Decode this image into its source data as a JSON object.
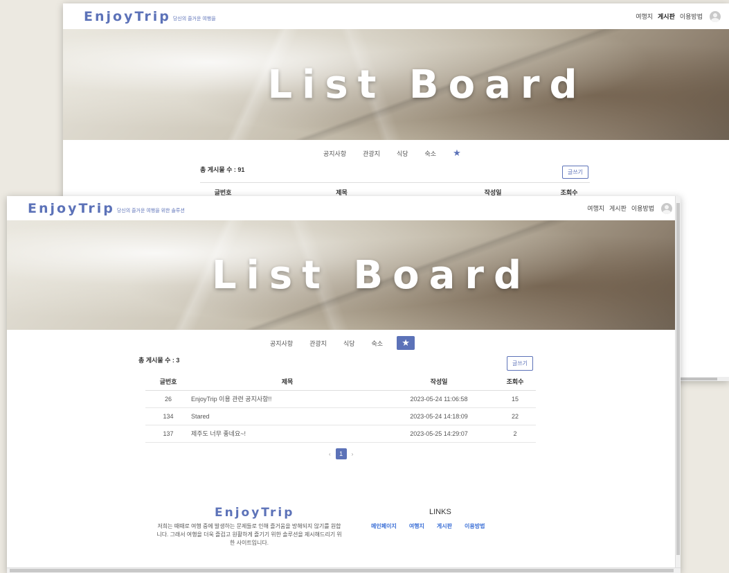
{
  "back_window": {
    "logo": "EnjoyTrip",
    "tagline": "당신의 즐거운 여행을",
    "nav": [
      "여행지",
      "게시판",
      "이용방법"
    ],
    "hero_title": "List Board",
    "tabs": [
      "공지사항",
      "관광지",
      "식당",
      "숙소"
    ],
    "total_label": "총 게시물 수 : 91",
    "write_button": "글쓰기",
    "columns": [
      "글번호",
      "제목",
      "작성일",
      "조회수"
    ]
  },
  "front_window": {
    "logo": "EnjoyTrip",
    "tagline": "당신의 즐거운 여행을 위한 솔루션",
    "nav": [
      "여행지",
      "게시판",
      "이용방법"
    ],
    "hero_title": "List Board",
    "tabs": [
      "공지사항",
      "관광지",
      "식당",
      "숙소"
    ],
    "total_label": "총 게시물 수 : 3",
    "write_button": "글쓰기",
    "columns": [
      "글번호",
      "제목",
      "작성일",
      "조회수"
    ],
    "rows": [
      {
        "no": "26",
        "title": "EnjoyTrip 이용 관련 공지사항!!",
        "date": "2023-05-24 11:06:58",
        "views": "15"
      },
      {
        "no": "134",
        "title": "Stared",
        "date": "2023-05-24 14:18:09",
        "views": "22"
      },
      {
        "no": "137",
        "title": "제주도 너무 좋네요~!",
        "date": "2023-05-25 14:29:07",
        "views": "2"
      }
    ],
    "pagination": {
      "prev": "‹",
      "current": "1",
      "next": "›"
    },
    "footer": {
      "logo": "EnjoyTrip",
      "description": "저희는 때때로 여행 중에 발생하는 문제들로 인해 즐거움을 방해되지 않기를 원합니다. 그래서 여행을 더욱 즐겁고 원활하게 즐기기 위한 솔루션을 제시해드리기 위한 사이트입니다.",
      "links_title": "LINKS",
      "links": [
        "메인페이지",
        "여행지",
        "게시판",
        "이용방법"
      ]
    }
  },
  "colors": {
    "accent": "#5c72b8",
    "link": "#3b6fd6"
  },
  "icons": {
    "favorite_tab": "star-icon",
    "profile": "avatar-icon"
  }
}
